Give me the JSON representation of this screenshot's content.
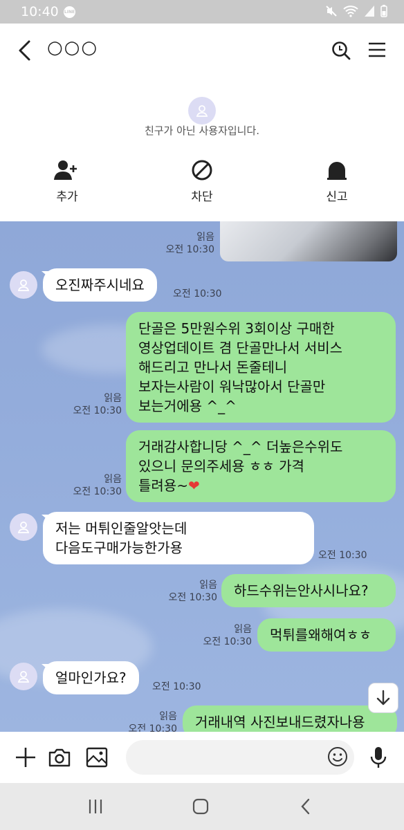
{
  "status_bar": {
    "time": "10:40",
    "app_badge": "LINE"
  },
  "header": {
    "title": "○○○"
  },
  "stranger_panel": {
    "notice": "친구가 아닌 사용자입니다.",
    "actions": [
      {
        "label": "추가",
        "icon": "add-friend-icon"
      },
      {
        "label": "차단",
        "icon": "block-icon"
      },
      {
        "label": "신고",
        "icon": "report-icon"
      }
    ]
  },
  "messages": [
    {
      "kind": "sent-photo",
      "read": "읽음",
      "time": "오전 10:30"
    },
    {
      "kind": "recv",
      "text": "오진짜주시네요",
      "time": "오전 10:30"
    },
    {
      "kind": "sent",
      "text": "단골은 5만원수위 3회이상 구매한\n영상업데이트 겸 단골만나서 서비스\n해드리고 만나서 돈줄테니\n보자는사람이 워낙많아서 단골만\n보는거에용 ^_^",
      "read": "읽음",
      "time": "오전 10:30"
    },
    {
      "kind": "sent",
      "text": "거래감사합니당 ^_^ 더높은수위도\n있으니 문의주세용 ㅎㅎ 가격\n틀려용~",
      "emoji": "❤",
      "read": "읽음",
      "time": "오전 10:30"
    },
    {
      "kind": "recv",
      "text": "저는 머튀인줄알앗는데\n다음도구매가능한가용",
      "time": "오전 10:30"
    },
    {
      "kind": "sent",
      "text": "하드수위는안사시나요?",
      "read": "읽음",
      "time": "오전 10:30"
    },
    {
      "kind": "sent",
      "text": "먹튀를왜해여ㅎㅎ",
      "read": "읽음",
      "time": "오전 10:30"
    },
    {
      "kind": "recv",
      "text": "얼마인가요?",
      "time": "오전 10:30"
    },
    {
      "kind": "sent",
      "text": "거래내역 사진보내드렸자나용",
      "read": "읽음",
      "time": "오전 10:30"
    }
  ],
  "colors": {
    "chat_bg": "#93acdb",
    "sent_bubble": "#9ee59a",
    "recv_bubble": "#ffffff",
    "heart": "#e53935"
  }
}
